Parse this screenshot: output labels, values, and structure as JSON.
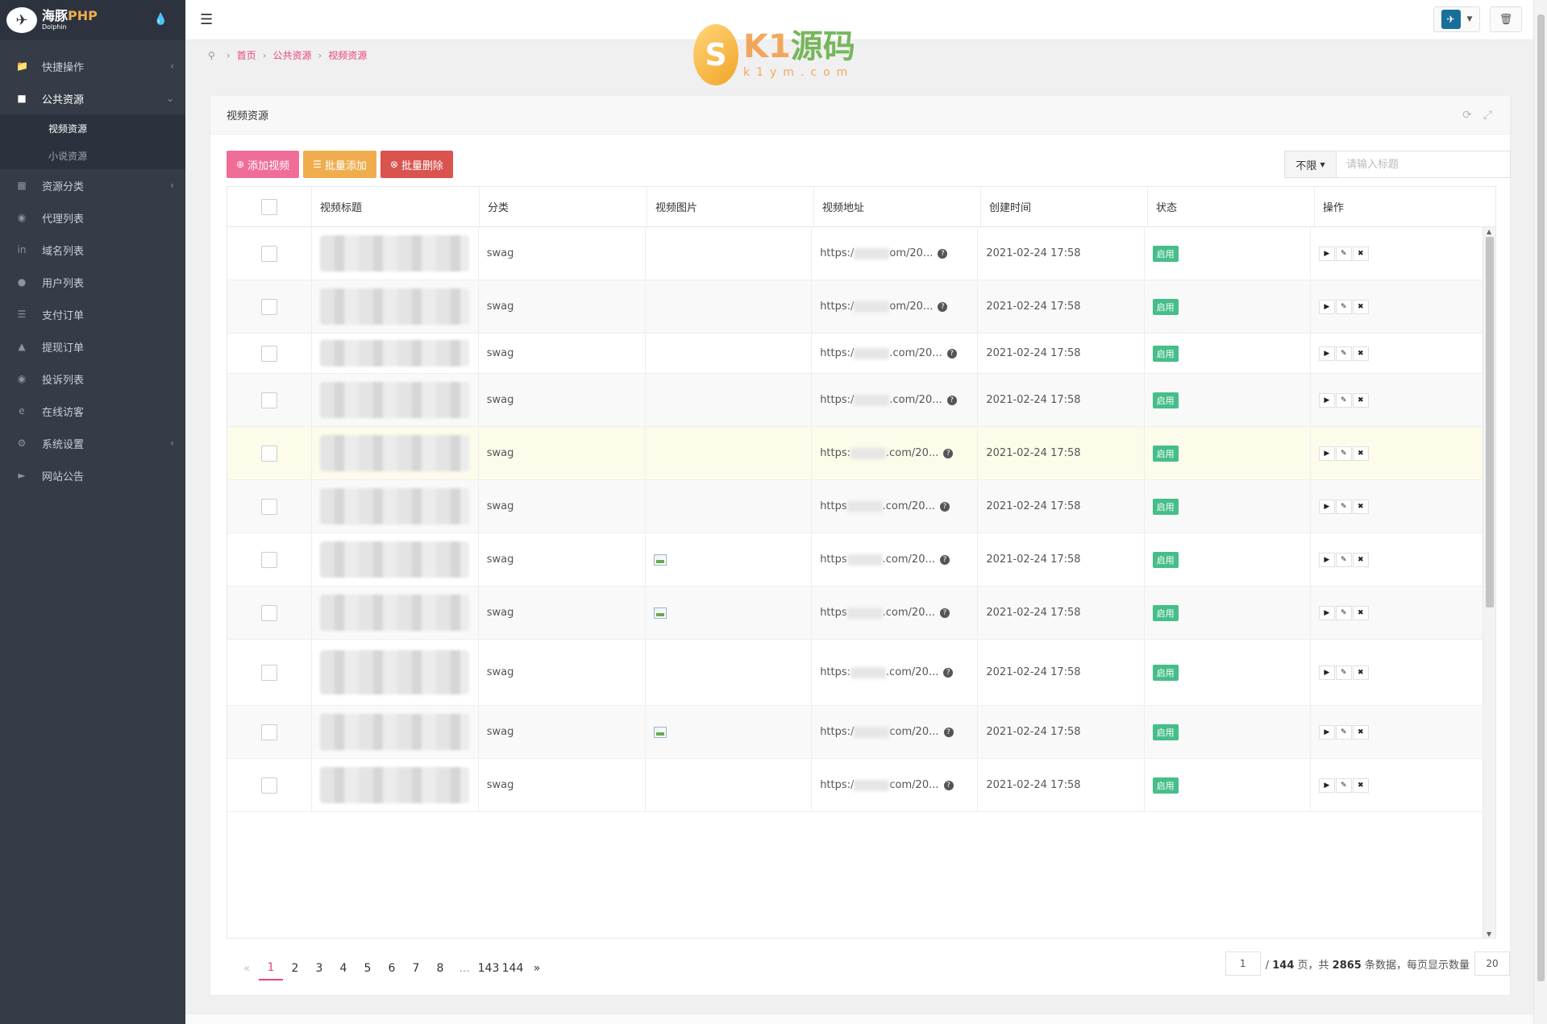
{
  "app": {
    "logo_title_main": "海豚",
    "logo_title_accent": "PHP",
    "logo_sub": "Dolphin"
  },
  "sidebar": {
    "items": [
      {
        "label": "快捷操作",
        "icon": "folder-icon"
      },
      {
        "label": "公共资源",
        "icon": "video-icon"
      },
      {
        "label": "资源分类",
        "icon": "grid-icon"
      },
      {
        "label": "代理列表",
        "icon": "users-icon"
      },
      {
        "label": "域名列表",
        "icon": "linkedin-icon"
      },
      {
        "label": "用户列表",
        "icon": "user-icon"
      },
      {
        "label": "支付订单",
        "icon": "list-icon"
      },
      {
        "label": "提现订单",
        "icon": "bank-icon"
      },
      {
        "label": "投诉列表",
        "icon": "alert-icon"
      },
      {
        "label": "在线访客",
        "icon": "ie-icon"
      },
      {
        "label": "系统设置",
        "icon": "gear-icon"
      },
      {
        "label": "网站公告",
        "icon": "bullhorn-icon"
      }
    ],
    "sub_items": [
      {
        "label": "视频资源"
      },
      {
        "label": "小说资源"
      }
    ]
  },
  "breadcrumb": [
    "首页",
    "公共资源",
    "视频资源"
  ],
  "watermark": {
    "title_a": "K1",
    "title_b": "源码",
    "sub": "k1ym.com"
  },
  "panel": {
    "title": "视频资源"
  },
  "toolbar": {
    "add": "添加视频",
    "batch_add": "批量添加",
    "batch_delete": "批量删除"
  },
  "search": {
    "filter": "不限",
    "placeholder": "请输入标题"
  },
  "table": {
    "headers": [
      "视频标题",
      "分类",
      "视频图片",
      "视频地址",
      "创建时间",
      "状态",
      "操作"
    ],
    "rows": [
      {
        "category": "swag",
        "url_a": "https:/",
        "url_b": "om/20...",
        "created": "2021-02-24 17:58",
        "status": "启用",
        "has_img": false
      },
      {
        "category": "swag",
        "url_a": "https:/",
        "url_b": "om/20...",
        "created": "2021-02-24 17:58",
        "status": "启用",
        "has_img": false
      },
      {
        "category": "swag",
        "url_a": "https:/",
        "url_b": ".com/20...",
        "created": "2021-02-24 17:58",
        "status": "启用",
        "has_img": false
      },
      {
        "category": "swag",
        "url_a": "https:/",
        "url_b": ".com/20...",
        "created": "2021-02-24 17:58",
        "status": "启用",
        "has_img": false
      },
      {
        "category": "swag",
        "url_a": "https:",
        "url_b": ".com/20...",
        "created": "2021-02-24 17:58",
        "status": "启用",
        "has_img": false
      },
      {
        "category": "swag",
        "url_a": "https",
        "url_b": ".com/20...",
        "created": "2021-02-24 17:58",
        "status": "启用",
        "has_img": false
      },
      {
        "category": "swag",
        "url_a": "https",
        "url_b": ".com/20...",
        "created": "2021-02-24 17:58",
        "status": "启用",
        "has_img": true
      },
      {
        "category": "swag",
        "url_a": "https",
        "url_b": ".com/20...",
        "created": "2021-02-24 17:58",
        "status": "启用",
        "has_img": true
      },
      {
        "category": "swag",
        "url_a": "https:",
        "url_b": ".com/20...",
        "created": "2021-02-24 17:58",
        "status": "启用",
        "has_img": false
      },
      {
        "category": "swag",
        "url_a": "https:/",
        "url_b": "com/20...",
        "created": "2021-02-24 17:58",
        "status": "启用",
        "has_img": true
      },
      {
        "category": "swag",
        "url_a": "https:/",
        "url_b": "com/20...",
        "created": "2021-02-24 17:58",
        "status": "启用",
        "has_img": false
      }
    ]
  },
  "pagination": {
    "pages": [
      "1",
      "2",
      "3",
      "4",
      "5",
      "6",
      "7",
      "8",
      "...",
      "143",
      "144"
    ],
    "prev": "«",
    "next": "»",
    "current_input": "1",
    "summary_a": "/ ",
    "total_pages": "144",
    "summary_b": " 页，共 ",
    "total_items": "2865",
    "summary_c": " 条数据，每页显示数量",
    "page_size": "20"
  },
  "colors": {
    "accent": "#e8447a",
    "sidebar": "#353c48",
    "success": "#46be8a",
    "warning": "#f0ad4e",
    "danger": "#d9534f"
  }
}
